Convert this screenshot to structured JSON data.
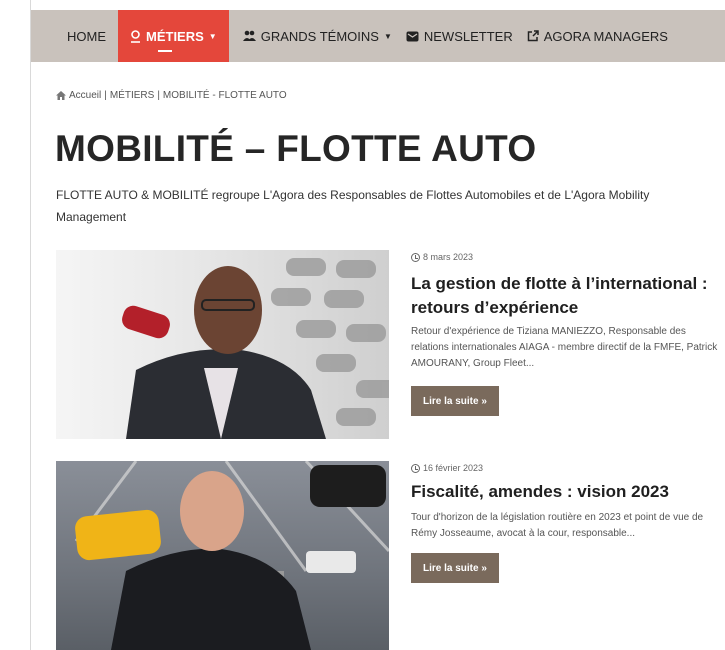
{
  "nav": {
    "home": "HOME",
    "metiers": "MÉTIERS",
    "grands_temoins": "GRANDS TÉMOINS",
    "newsletter": "NEWSLETTER",
    "agora_managers": "AGORA MANAGERS",
    "active_color": "#e4473b",
    "bar_color": "#c9c2bc"
  },
  "breadcrumb": {
    "home": "Accueil",
    "sep": "|",
    "category": "MÉTIERS",
    "current": "MOBILITÉ - FLOTTE AUTO"
  },
  "page": {
    "title": "MOBILITÉ – FLOTTE AUTO",
    "intro": "FLOTTE AUTO & MOBILITÉ regroupe L'Agora des Responsables de Flottes Automobiles et de L'Agora Mobility Management"
  },
  "articles": [
    {
      "date": "8 mars 2023",
      "title": "La gestion de flotte à l’international : retours d’expérience",
      "excerpt": "Retour d'expérience de Tiziana MANIEZZO, Responsable des relations internationales AIAGA - membre directif de la FMFE, Patrick AMOURANY, Group Fleet...",
      "button": "Lire la suite »"
    },
    {
      "date": "16 février 2023",
      "title": "Fiscalité, amendes : vision 2023",
      "excerpt": "Tour d'horizon de la législation routière en 2023 et point de vue de Rémy Josseaume, avocat à la cour, responsable...",
      "button": "Lire la suite »"
    }
  ],
  "button_color": "#7a6a5c"
}
